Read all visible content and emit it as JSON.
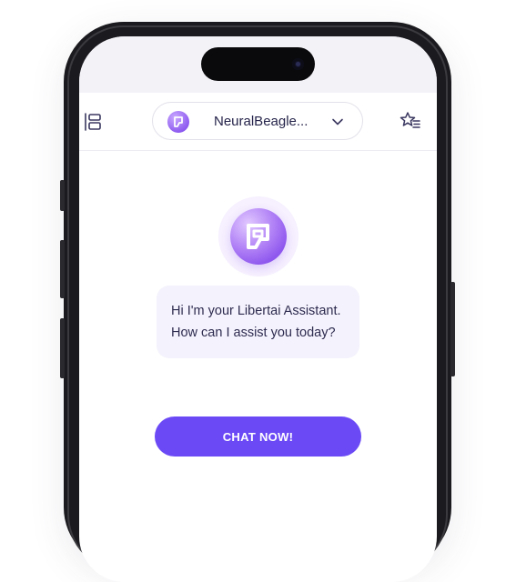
{
  "header": {
    "model_name": "NeuralBeagle...",
    "icons": {
      "sidebar": "sidebar-toggle-icon",
      "model_logo": "libertai-logo-icon",
      "dropdown": "chevron-down-icon",
      "favorites": "star-list-icon"
    }
  },
  "main": {
    "greeting_lines": [
      "Hi I'm your Libertai Assistant.",
      "How can I assist you today?"
    ],
    "cta_label": "CHAT NOW!",
    "avatar_icon": "libertai-logo-icon"
  },
  "colors": {
    "accent": "#6b4af6",
    "bubble_bg": "#f4f2fc",
    "text": "#2d2b4f"
  }
}
